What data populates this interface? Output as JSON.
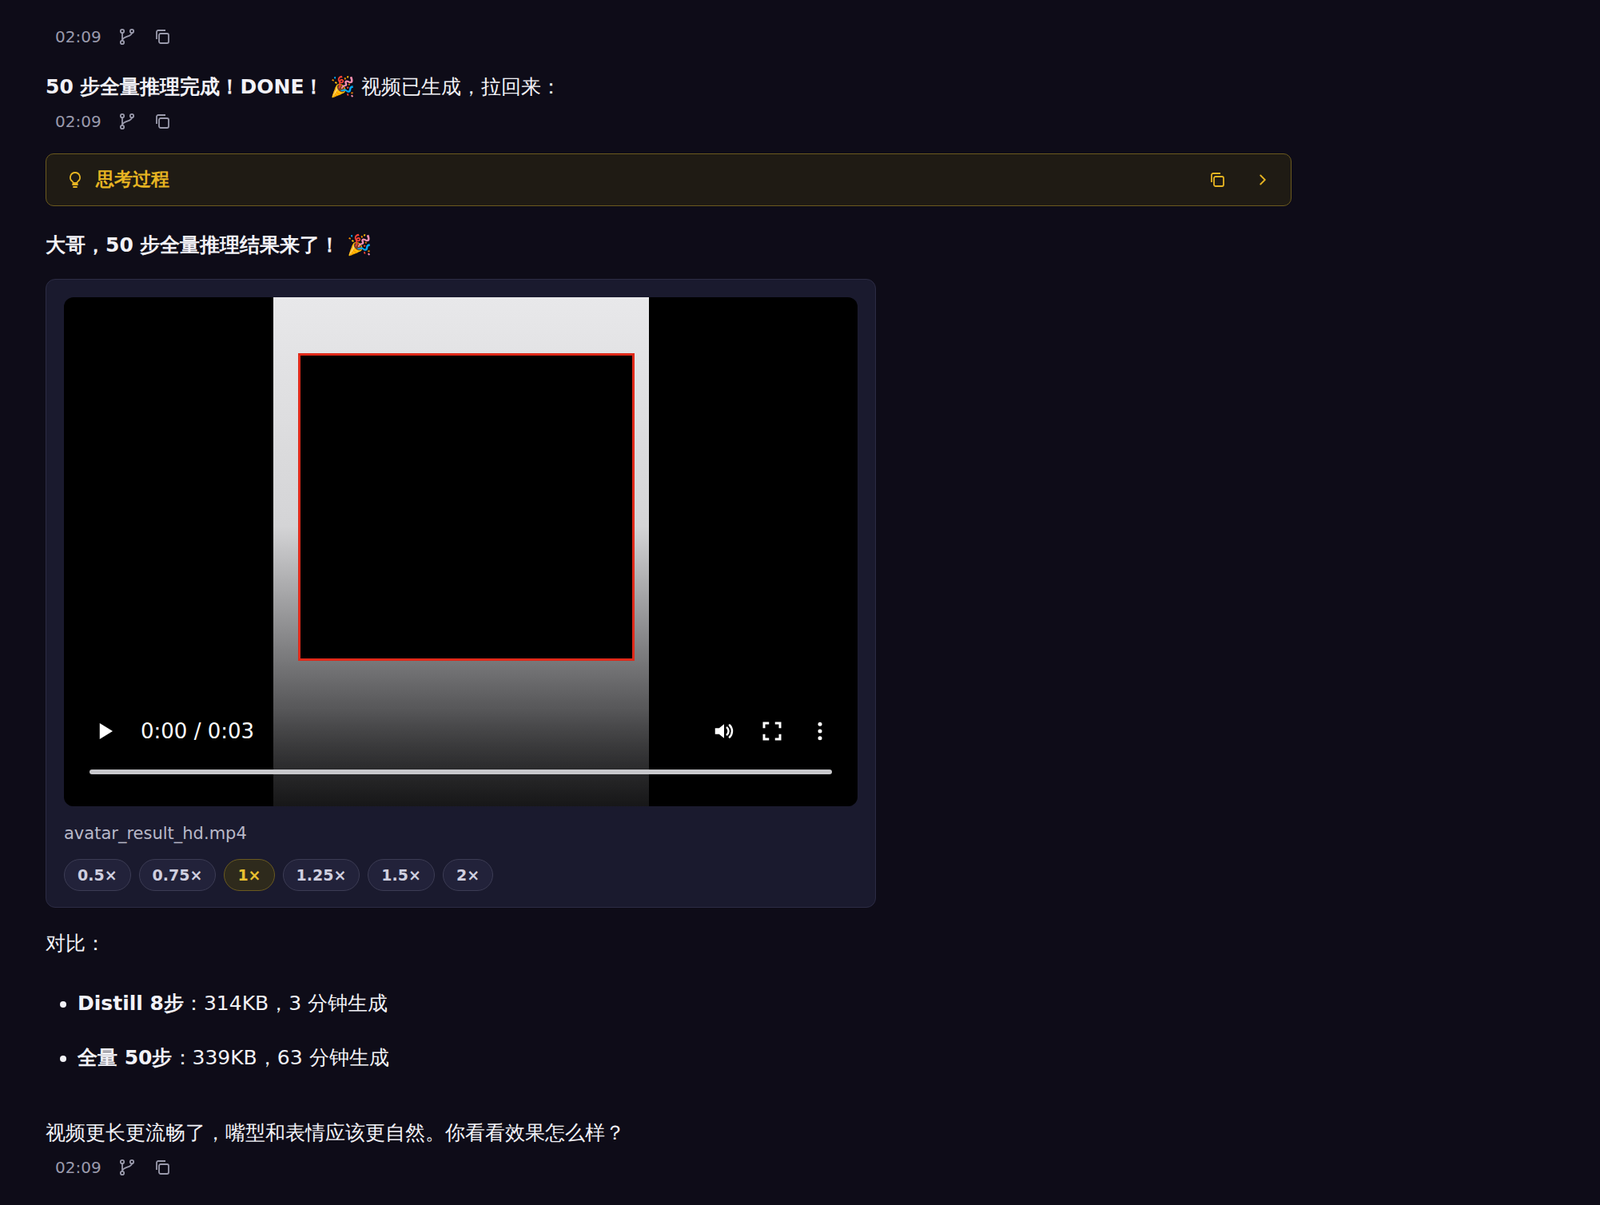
{
  "feed": [
    {
      "kind": "meta",
      "time": "02:09"
    },
    {
      "kind": "text",
      "segments": [
        {
          "text": "50 步全量推理完成！DONE！",
          "bold": true
        },
        {
          "text": " 🎉 视频已生成，拉回来：",
          "bold": false
        }
      ]
    },
    {
      "kind": "meta",
      "time": "02:09"
    },
    {
      "kind": "thinking",
      "label": "思考过程",
      "expanded": false
    },
    {
      "kind": "text",
      "segments": [
        {
          "text": "大哥，50 步全量推理结果来了！ 🎉",
          "bold": true
        }
      ]
    },
    {
      "kind": "video",
      "file": "avatar_result_hd.mp4",
      "playing": false,
      "time": "0:00 / 0:03",
      "level": 0,
      "speeds": [
        {
          "label": "0.5×",
          "selected": false
        },
        {
          "label": "0.75×",
          "selected": false
        },
        {
          "label": "1×",
          "selected": true
        },
        {
          "label": "1.25×",
          "selected": false
        },
        {
          "label": "1.5×",
          "selected": false
        },
        {
          "label": "2×",
          "selected": false
        }
      ]
    },
    {
      "kind": "text",
      "segments": [
        {
          "text": "对比：",
          "bold": false
        }
      ]
    },
    {
      "kind": "list",
      "items": [
        {
          "label": "Distill 8步",
          "value": "：314KB，3 分钟生成"
        },
        {
          "label": "全量 50步",
          "value": "：339KB，63 分钟生成"
        }
      ]
    },
    {
      "kind": "text",
      "segments": [
        {
          "text": "视频更长更流畅了，嘴型和表情应该更自然。你看看效果怎么样？",
          "bold": false
        }
      ]
    },
    {
      "kind": "meta",
      "time": "02:09"
    }
  ]
}
